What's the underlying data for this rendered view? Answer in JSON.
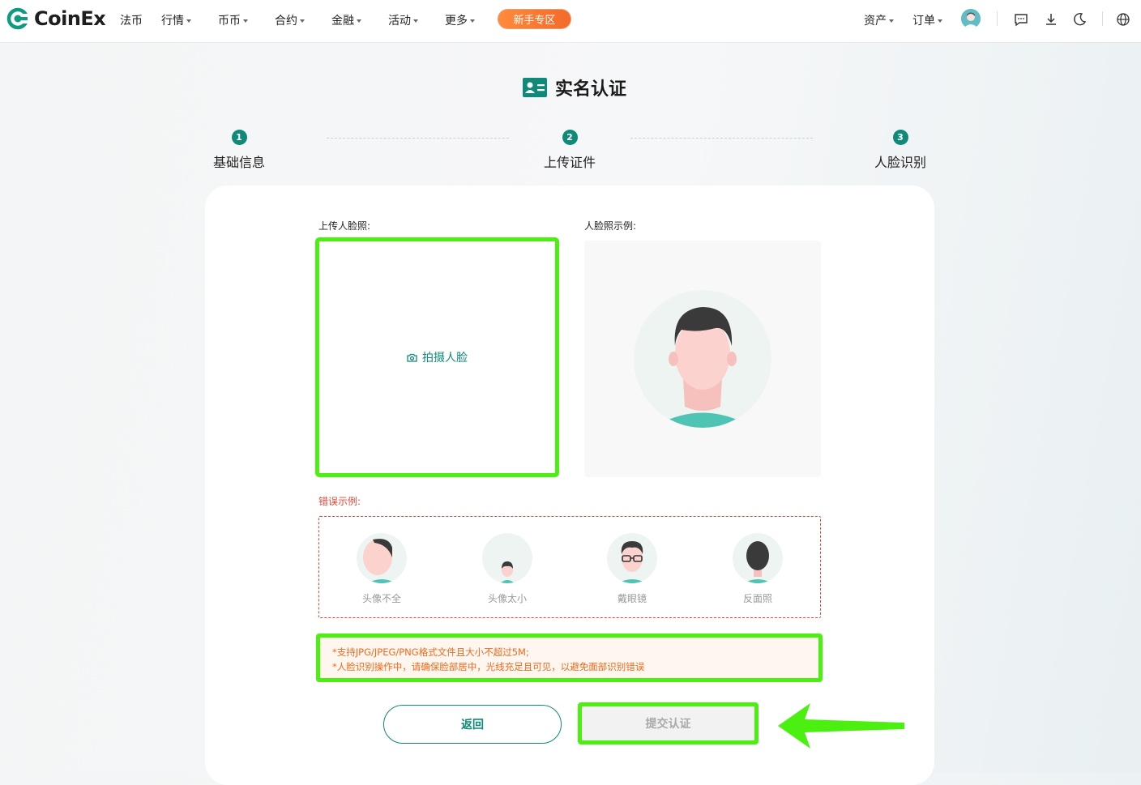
{
  "nav": {
    "brand": "CoinEx",
    "items": [
      {
        "label": "法币",
        "dropdown": false
      },
      {
        "label": "行情",
        "dropdown": true
      },
      {
        "label": "币币",
        "dropdown": true
      },
      {
        "label": "合约",
        "dropdown": true
      },
      {
        "label": "金融",
        "dropdown": true
      },
      {
        "label": "活动",
        "dropdown": true
      },
      {
        "label": "更多",
        "dropdown": true
      }
    ],
    "newbie_label": "新手专区",
    "assets_label": "资产",
    "orders_label": "订单",
    "icons": [
      "avatar",
      "message-icon",
      "download-icon",
      "moon-icon",
      "globe-icon"
    ]
  },
  "page": {
    "title": "实名认证",
    "steps": [
      {
        "num": "1",
        "label": "基础信息"
      },
      {
        "num": "2",
        "label": "上传证件"
      },
      {
        "num": "3",
        "label": "人脸识别"
      }
    ],
    "current_step": 3
  },
  "upload": {
    "label": "上传人脸照:",
    "button": "拍摄人脸",
    "example_label": "人脸照示例:"
  },
  "errors": {
    "label": "错误示例:",
    "items": [
      "头像不全",
      "头像太小",
      "戴眼镜",
      "反面照"
    ]
  },
  "tips": {
    "line1": "*支持JPG/JPEG/PNG格式文件且大小不超过5M;",
    "line2": "*人脸识别操作中，请确保脸部居中，光线充足且可见，以避免面部识别错误"
  },
  "actions": {
    "back": "返回",
    "submit": "提交认证"
  },
  "colors": {
    "brand": "#0f8a78",
    "highlight": "#4cf010",
    "error": "#e5483a",
    "tip": "#f06a1e",
    "newbie": "#f36a2b"
  }
}
